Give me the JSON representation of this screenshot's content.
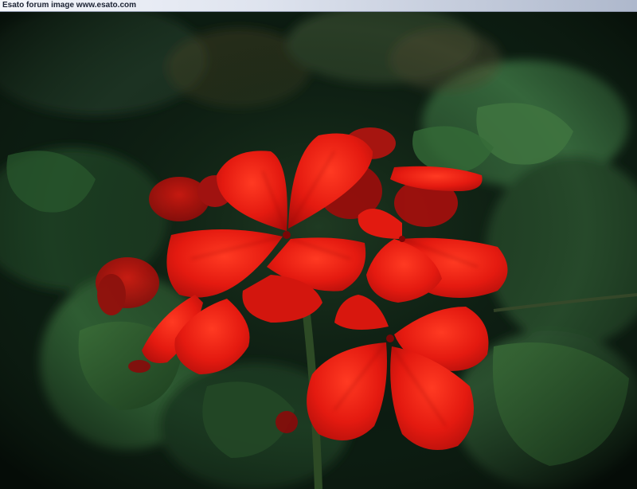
{
  "banner": {
    "text": "Esato forum image www.esato.com"
  },
  "photo": {
    "subject": "red-geranium-flower-cluster",
    "colors": {
      "petal": "#e0190f",
      "petal_dark": "#a80d0a",
      "leaf": "#2c5a2c",
      "background": "#0b1a10"
    }
  }
}
